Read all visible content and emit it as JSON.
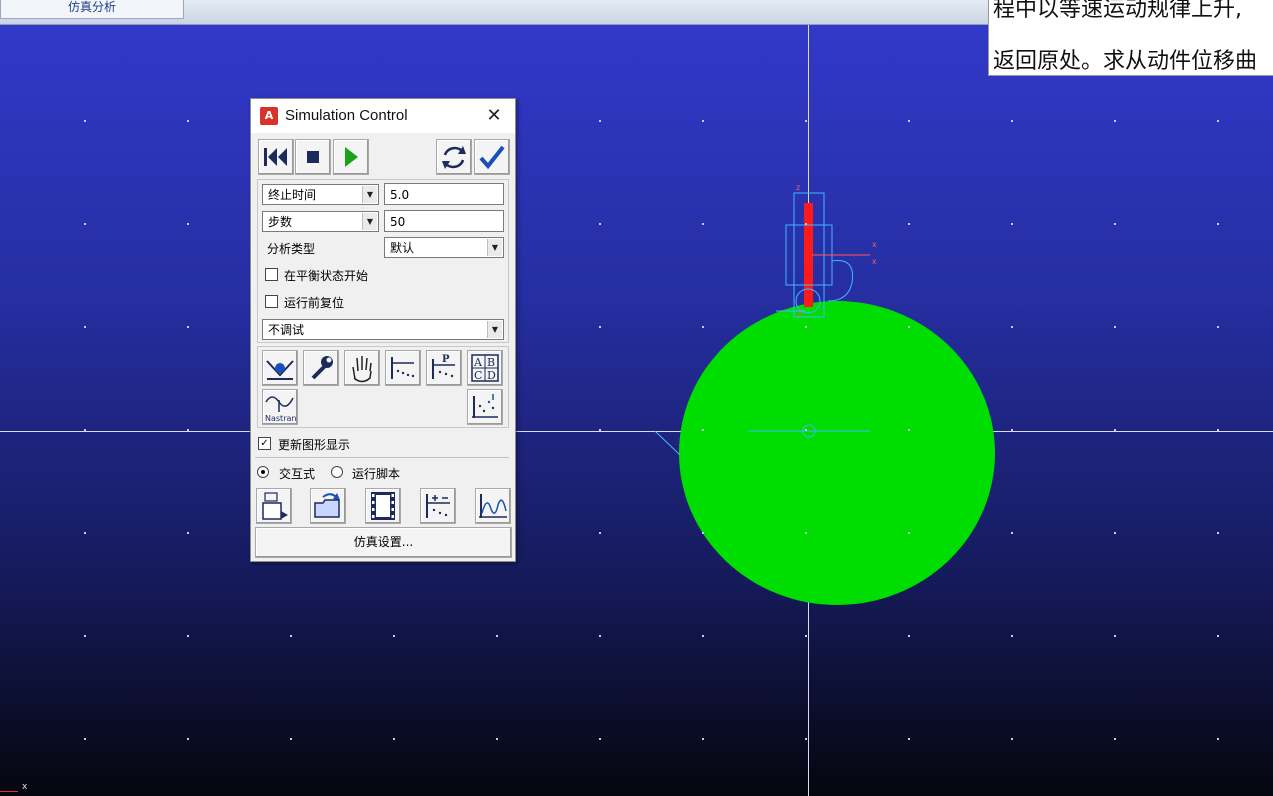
{
  "top_tab": {
    "label": "仿真分析"
  },
  "viewport": {
    "axis_label": "x"
  },
  "text_image": {
    "line1": "程中以等速运动规律上升,",
    "line2": "返回原处。求从动件位移曲"
  },
  "dialog": {
    "app_icon_letter": "A",
    "title": "Simulation Control",
    "close_glyph": "✕",
    "end_type": {
      "selected": "终止时间"
    },
    "end_value": "5.0",
    "steps_type": {
      "selected": "步数"
    },
    "steps_value": "50",
    "analysis_type_label": "分析类型",
    "analysis_type": {
      "selected": "默认"
    },
    "start_at_equilibrium": {
      "label": "在平衡状态开始",
      "checked": false
    },
    "reset_before_run": {
      "label": "运行前复位",
      "checked": false
    },
    "debug": {
      "selected": "不调试"
    },
    "update_graphics": {
      "label": "更新图形显示",
      "checked": true,
      "mark": "✓"
    },
    "mode_interactive": "交互式",
    "mode_script": "运行脚本",
    "setup_button": "仿真设置...",
    "nastran_label": "Nastran",
    "abcd_label": "AB CD",
    "p_label": "P"
  },
  "colors": {
    "cam": "#00dd00",
    "follower": "#ff1a1a",
    "marker": "#3fb7ff",
    "play": "#1aa31a",
    "check": "#1a4fb8"
  },
  "icons": [
    "rewind-icon",
    "stop-icon",
    "play-icon",
    "reset-refresh-icon",
    "check-icon",
    "equilibrium-icon",
    "wrench-icon",
    "hand-icon",
    "plot-icon",
    "plot-p-icon",
    "abcd-icon",
    "nastran-icon",
    "plot-dots-icon",
    "import-icon",
    "open-icon",
    "film-icon",
    "measure-icon",
    "curve-icon"
  ]
}
